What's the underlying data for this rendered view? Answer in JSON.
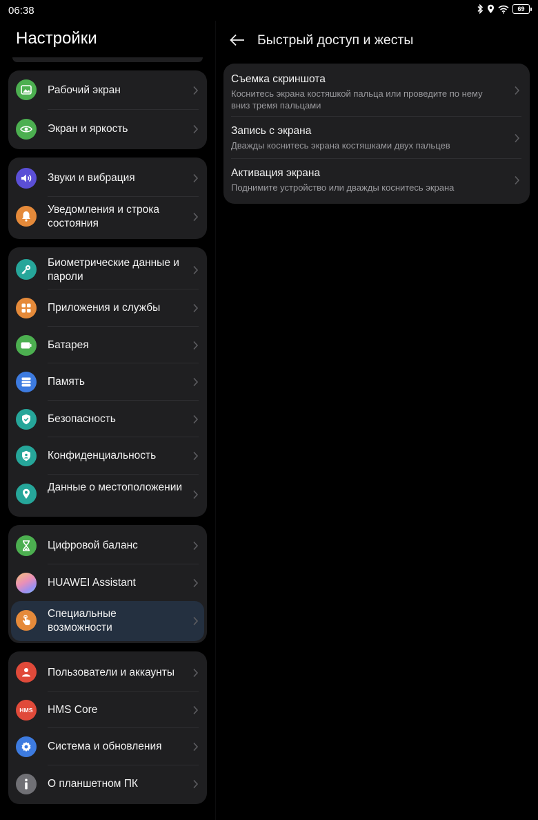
{
  "status_bar": {
    "time": "06:38",
    "battery": "69"
  },
  "left": {
    "title": "Настройки",
    "groups": [
      {
        "items": [
          {
            "label": "Рабочий экран",
            "icon": "image-icon",
            "color": "#4caf50"
          },
          {
            "label": "Экран и яркость",
            "icon": "eye-icon",
            "color": "#4caf50"
          }
        ]
      },
      {
        "items": [
          {
            "label": "Звуки и вибрация",
            "icon": "speaker-icon",
            "color": "#5b4fd6"
          },
          {
            "label": "Уведомления и строка состояния",
            "icon": "bell-icon",
            "color": "#e58a3a"
          }
        ]
      },
      {
        "items": [
          {
            "label": "Биометрические данные и пароли",
            "icon": "key-icon",
            "color": "#26a69a"
          },
          {
            "label": "Приложения и службы",
            "icon": "apps-grid-icon",
            "color": "#e58a3a"
          },
          {
            "label": "Батарея",
            "icon": "battery-icon",
            "color": "#4caf50"
          },
          {
            "label": "Память",
            "icon": "storage-icon",
            "color": "#3d7be0"
          },
          {
            "label": "Безопасность",
            "icon": "shield-icon",
            "color": "#26a69a"
          },
          {
            "label": "Конфиденциальность",
            "icon": "privacy-shield-icon",
            "color": "#26a69a"
          },
          {
            "label": "Данные о местоположении",
            "icon": "location-pin-icon",
            "color": "#26a69a"
          }
        ]
      },
      {
        "items": [
          {
            "label": "Цифровой баланс",
            "icon": "hourglass-icon",
            "color": "#4caf50"
          },
          {
            "label": "HUAWEI Assistant",
            "icon": "assistant-orb-icon",
            "color": "#c98fe0"
          },
          {
            "label": "Специальные возможности",
            "icon": "hand-touch-icon",
            "color": "#e58a3a",
            "selected": true
          }
        ]
      },
      {
        "items": [
          {
            "label": "Пользователи и аккаунты",
            "icon": "user-icon",
            "color": "#e04a3a"
          },
          {
            "label": "HMS Core",
            "icon": "hms-logo-icon",
            "color": "#e04a3a",
            "badge": "HMS"
          },
          {
            "label": "Система и обновления",
            "icon": "gear-icon",
            "color": "#3d7be0"
          },
          {
            "label": "О планшетном ПК",
            "icon": "info-icon",
            "color": "#707075"
          }
        ]
      }
    ]
  },
  "right": {
    "title": "Быстрый доступ и жесты",
    "items": [
      {
        "title": "Съемка скриншота",
        "subtitle": "Коснитесь экрана костяшкой пальца или проведите по нему вниз тремя пальцами"
      },
      {
        "title": "Запись с экрана",
        "subtitle": "Дважды коснитесь экрана костяшками двух пальцев"
      },
      {
        "title": "Активация экрана",
        "subtitle": "Поднимите устройство или дважды коснитесь экрана"
      }
    ]
  }
}
